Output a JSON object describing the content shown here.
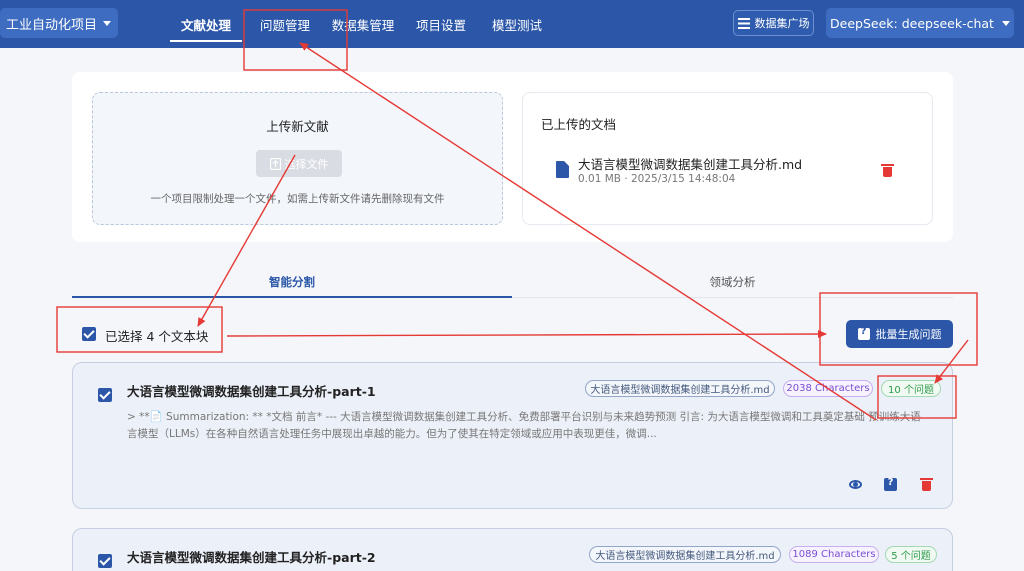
{
  "header": {
    "project_selector": "工业自动化项目",
    "nav": [
      "文献处理",
      "问题管理",
      "数据集管理",
      "项目设置",
      "模型测试"
    ],
    "active_nav": "文献处理",
    "dataset_plaza_label": "数据集广场",
    "model_selector": "DeepSeek: deepseek-chat"
  },
  "upload": {
    "title": "上传新文献",
    "choose_button": "选择文件",
    "note": "一个项目限制处理一个文件，如需上传新文件请先删除现有文件"
  },
  "uploaded_docs": {
    "title": "已上传的文档",
    "file_name": "大语言模型微调数据集创建工具分析.md",
    "file_meta": "0.01 MB · 2025/3/15 14:48:04"
  },
  "tabs": [
    "智能分割",
    "领域分析"
  ],
  "active_tab": "智能分割",
  "selection": {
    "label": "已选择 4 个文本块",
    "batch_button": "批量生成问题"
  },
  "chunks": [
    {
      "title": "大语言模型微调数据集创建工具分析-part-1",
      "file_tag": "大语言模型微调数据集创建工具分析.md",
      "chars_tag": "2038 Characters",
      "questions_tag": "10 个问题",
      "preview_line1": "> **📄 Summarization: ** *文档 前言* --- 大语言模型微调数据集创建工具分析、免费部署平台识别与未来趋势预测 引言: 为大语言模型微调和工具奠定基础 预训练大语",
      "preview_line2": "言模型（LLMs）在各种自然语言处理任务中展现出卓越的能力。但为了使其在特定领域或应用中表现更佳，微调..."
    },
    {
      "title": "大语言模型微调数据集创建工具分析-part-2",
      "file_tag": "大语言模型微调数据集创建工具分析.md",
      "chars_tag": "1089 Characters",
      "questions_tag": "5 个问题"
    }
  ],
  "colors": {
    "primary": "#2c57a8",
    "annotation_red": "#e53935"
  }
}
